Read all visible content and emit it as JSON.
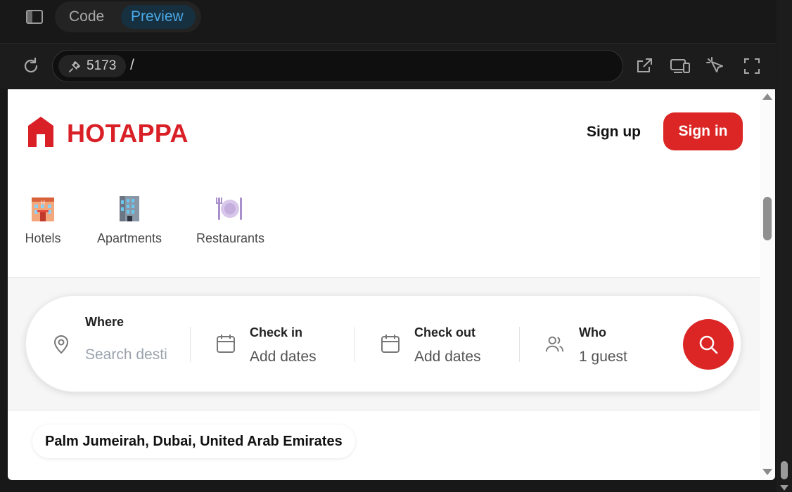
{
  "ide": {
    "tabs": [
      {
        "label": "Code"
      },
      {
        "label": "Preview"
      }
    ],
    "active_tab": "Preview",
    "port": "5173",
    "path": "/",
    "icons": [
      "sidebar-toggle-icon",
      "reload-icon",
      "plug-icon",
      "open-external-icon",
      "devices-icon",
      "inspect-icon",
      "fullscreen-icon"
    ]
  },
  "site": {
    "brand": "HOTAPPA",
    "brand_color": "#d92027",
    "accent": "#dc2626",
    "nav": {
      "signup": "Sign up",
      "signin": "Sign in"
    },
    "categories": [
      {
        "label": "Hotels",
        "icon": "hotel-icon"
      },
      {
        "label": "Apartments",
        "icon": "apartment-building-icon"
      },
      {
        "label": "Restaurants",
        "icon": "plate-cutlery-icon"
      }
    ],
    "search": {
      "where": {
        "title": "Where",
        "placeholder": "Search destinations",
        "icon": "location-pin-icon"
      },
      "checkin": {
        "title": "Check in",
        "value": "Add dates",
        "icon": "calendar-icon"
      },
      "checkout": {
        "title": "Check out",
        "value": "Add dates",
        "icon": "calendar-icon"
      },
      "who": {
        "title": "Who",
        "value": "1 guest",
        "icon": "users-icon"
      },
      "button_icon": "search-icon"
    },
    "location_chip": "Palm Jumeirah, Dubai, United Arab Emirates"
  }
}
